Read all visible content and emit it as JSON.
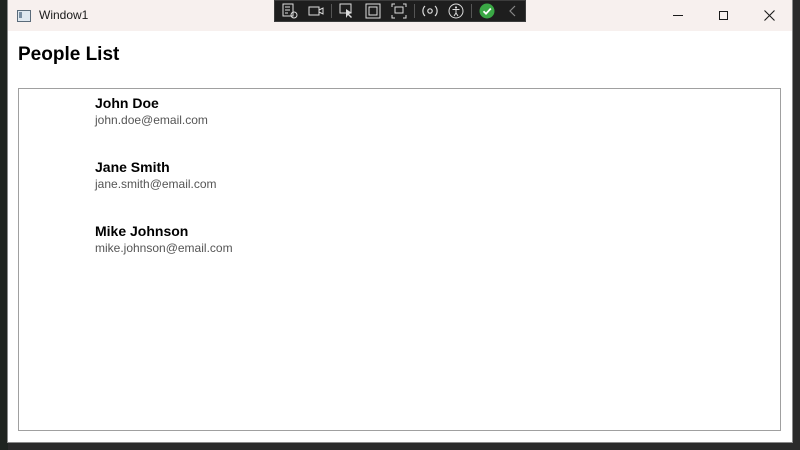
{
  "window": {
    "title": "Window1"
  },
  "devtools": {
    "icons": [
      "live-visual-tree-icon",
      "record-icon",
      "select-element-icon",
      "display-layout-adorners-icon",
      "track-focus-icon",
      "hot-reload-icon",
      "accessibility-icon",
      "binding-ok-icon",
      "collapse-chevron-icon"
    ]
  },
  "page": {
    "title": "People List"
  },
  "people": [
    {
      "name": "John Doe",
      "email": "john.doe@email.com"
    },
    {
      "name": "Jane Smith",
      "email": "jane.smith@email.com"
    },
    {
      "name": "Mike Johnson",
      "email": "mike.johnson@email.com"
    }
  ],
  "colors": {
    "titlebar": "#f7f0ee",
    "devbar": "#1e1e1e",
    "check_green": "#3aa845"
  }
}
